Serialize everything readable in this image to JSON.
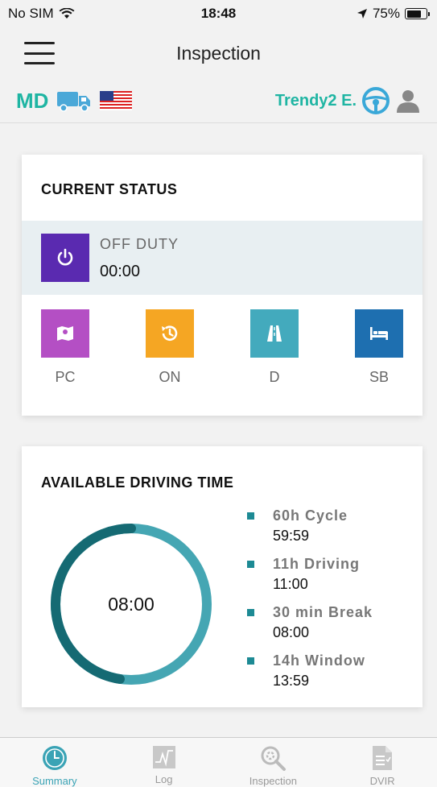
{
  "statusbar": {
    "carrier": "No SIM",
    "time": "18:48",
    "battery": "75%",
    "battery_level": 0.75
  },
  "nav": {
    "title": "Inspection"
  },
  "infobar": {
    "region": "MD",
    "driver_name": "Trendy2 E."
  },
  "current_status": {
    "title": "CURRENT STATUS",
    "status_label": "OFF DUTY",
    "status_time": "00:00",
    "buttons": [
      {
        "label": "PC",
        "color": "#b44fc4"
      },
      {
        "label": "ON",
        "color": "#f5a623"
      },
      {
        "label": "D",
        "color": "#43aabd"
      },
      {
        "label": "SB",
        "color": "#1e6fb0"
      }
    ]
  },
  "driving_time": {
    "title": "AVAILABLE DRIVING TIME",
    "center_time": "08:00",
    "items": [
      {
        "name": "60h Cycle",
        "value": "59:59"
      },
      {
        "name": "11h Driving",
        "value": "11:00"
      },
      {
        "name": "30 min Break",
        "value": "08:00"
      },
      {
        "name": "14h Window",
        "value": "13:59"
      }
    ]
  },
  "tabs": [
    {
      "label": "Summary",
      "icon": "clock-icon",
      "active": true
    },
    {
      "label": "Log",
      "icon": "log-chart-icon",
      "active": false
    },
    {
      "label": "Inspection",
      "icon": "inspection-search-icon",
      "active": false
    },
    {
      "label": "DVIR",
      "icon": "dvir-document-icon",
      "active": false
    }
  ],
  "colors": {
    "accent": "#1fb5a3",
    "offduty": "#5a2ab0",
    "ring_dark": "#156a73",
    "ring_light": "#45a6b3",
    "tab_active": "#3aa3b5"
  }
}
